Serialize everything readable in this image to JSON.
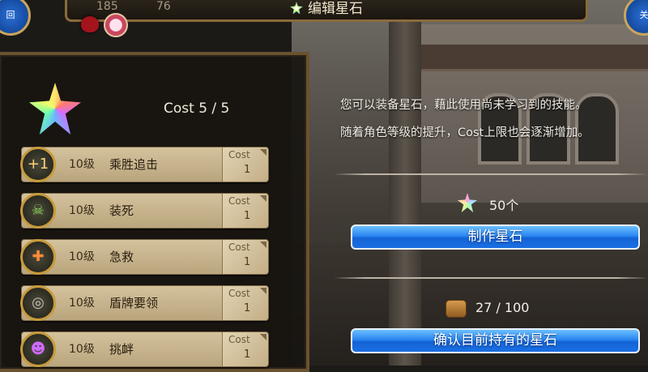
{
  "header": {
    "title": "编辑星石",
    "stat_left": "185",
    "stat_right": "76",
    "corner_left_label": "回",
    "corner_right_label": "关"
  },
  "panel": {
    "cost_summary": "Cost 5 / 5",
    "skills": [
      {
        "level": "10级",
        "name": "乘胜追击",
        "cost_label": "Cost",
        "cost": "1",
        "icon": "sword-plus-icon",
        "badge": "+1"
      },
      {
        "level": "10级",
        "name": "装死",
        "cost_label": "Cost",
        "cost": "1",
        "icon": "fallen-figure-icon"
      },
      {
        "level": "10级",
        "name": "急救",
        "cost_label": "Cost",
        "cost": "1",
        "icon": "first-aid-icon"
      },
      {
        "level": "10级",
        "name": "盾牌要领",
        "cost_label": "Cost",
        "cost": "1",
        "icon": "shield-icon"
      },
      {
        "level": "10级",
        "name": "挑衅",
        "cost_label": "Cost",
        "cost": "1",
        "icon": "taunt-figure-icon"
      }
    ]
  },
  "info": {
    "line1": "您可以装备星石，藉此使用尚未学习到的技能。",
    "line2": "随着角色等级的提升，Cost上限也会逐渐增加。"
  },
  "craft": {
    "count": "50个",
    "button_label": "制作星石"
  },
  "holding": {
    "count": "27 / 100",
    "button_label": "确认目前持有的星石"
  }
}
